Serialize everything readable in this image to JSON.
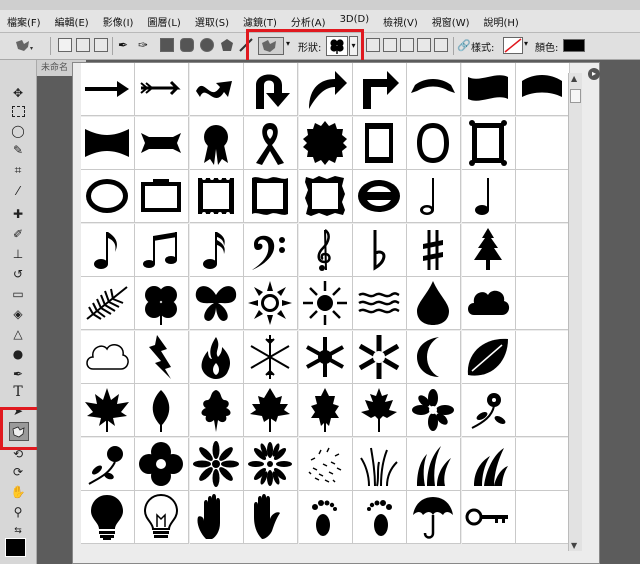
{
  "menubar": {
    "top_text": "",
    "items": [
      "檔案(F)",
      "編輯(E)",
      "影像(I)",
      "圖層(L)",
      "選取(S)",
      "濾鏡(T)",
      "分析(A)",
      "3D(D)",
      "檢視(V)",
      "視窗(W)",
      "說明(H)"
    ]
  },
  "options": {
    "shape_label": "形狀:",
    "style_label": "樣式:",
    "color_label": "顏色:"
  },
  "document": {
    "tab_title": "未命名"
  },
  "colors": {
    "highlight": "#e0191f",
    "swatch": "#000000"
  },
  "shape_panel": {
    "columns": 9,
    "rows": [
      [
        "arrow-icon",
        "arrow-feather-icon",
        "wavy-arrow-icon",
        "u-turn-arrow-icon",
        "curved-arrow-icon",
        "corner-arrow-icon",
        "banner-ribbon-icon",
        "banner-wave-icon",
        "banner-arc-icon"
      ],
      [
        "banner-concave-icon",
        "banner-scroll-icon",
        "award-ribbon-icon",
        "awareness-ribbon-icon",
        "seal-icon",
        "frame-rect-icon",
        "frame-oval-icon",
        "frame-ornate-icon",
        "empty"
      ],
      [
        "frame-oval-ornate-icon",
        "frame-rect-decor-icon",
        "frame-scallop-icon",
        "frame-wave-icon",
        "frame-rough-icon",
        "frame-oval-bold-icon",
        "half-note-icon",
        "quarter-note-icon",
        "empty"
      ],
      [
        "eighth-note-icon",
        "beamed-notes-icon",
        "sixteenth-note-icon",
        "bass-clef-icon",
        "treble-clef-icon",
        "flat-sign-icon",
        "sharp-sign-icon",
        "pine-tree-icon",
        "empty"
      ],
      [
        "fern-icon",
        "clover-icon",
        "butterfly-icon",
        "sun-icon",
        "sun-rays-icon",
        "water-waves-icon",
        "raindrop-icon",
        "cloud-icon",
        "empty"
      ],
      [
        "cloud-outline-icon",
        "lightning-icon",
        "fire-icon",
        "snowflake-thin-icon",
        "snowflake-icon",
        "snowflake-bold-icon",
        "moon-icon",
        "leaf-round-icon",
        "empty"
      ],
      [
        "maple-leaf-icon",
        "leaf-icon",
        "leaf-oak-icon",
        "maple-leaf-2-icon",
        "leaf-holly-icon",
        "maple-leaf-3-icon",
        "flower-icon",
        "flower-sprig-icon",
        "empty"
      ],
      [
        "flower-vine-icon",
        "flower-4petal-icon",
        "daisy-icon",
        "sunflower-icon",
        "dandelion-icon",
        "grass-icon",
        "grass-2-icon",
        "grass-3-icon",
        "empty"
      ],
      [
        "lightbulb-icon",
        "lightbulb-outline-icon",
        "hand-icon",
        "hand-2-icon",
        "footprint-icon",
        "footprint-2-icon",
        "umbrella-icon",
        "key-icon",
        "empty"
      ]
    ]
  }
}
